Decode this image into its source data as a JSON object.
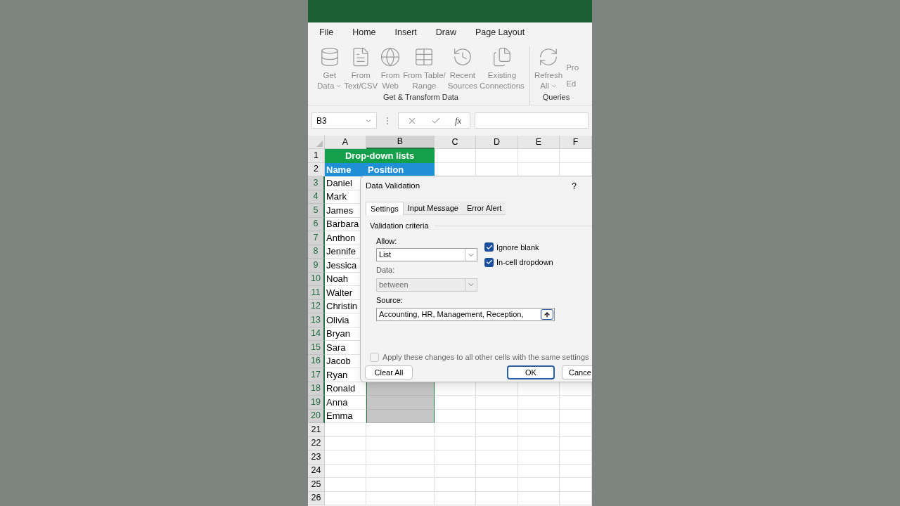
{
  "ribbon_tabs": [
    {
      "label": "File"
    },
    {
      "label": "Home"
    },
    {
      "label": "Insert"
    },
    {
      "label": "Draw"
    },
    {
      "label": "Page Layout"
    }
  ],
  "ribbon_groups": [
    {
      "label": "Get & Transform Data",
      "buttons": [
        {
          "kind": "database",
          "lines": [
            "Get",
            "Data"
          ],
          "dropdown": true
        },
        {
          "kind": "document",
          "lines": [
            "From",
            "Text/CSV"
          ],
          "dropdown": false
        },
        {
          "kind": "web",
          "lines": [
            "From",
            "Web"
          ],
          "dropdown": false
        },
        {
          "kind": "table",
          "lines": [
            "From Table/",
            "Range"
          ],
          "dropdown": false
        },
        {
          "kind": "recent",
          "lines": [
            "Recent",
            "Sources"
          ],
          "dropdown": false
        },
        {
          "kind": "existing",
          "lines": [
            "Existing",
            "Connections"
          ],
          "dropdown": false
        }
      ]
    },
    {
      "label": "Queries",
      "buttons": [
        {
          "kind": "refresh",
          "lines": [
            "Refresh",
            "All"
          ],
          "dropdown": true
        }
      ],
      "small_items": [
        "Pro",
        "Ed"
      ]
    }
  ],
  "name_box": "B3",
  "formula_function": "fx",
  "columns": [
    {
      "label": "A",
      "selected": false
    },
    {
      "label": "B",
      "selected": true
    },
    {
      "label": "C",
      "selected": false
    },
    {
      "label": "D",
      "selected": false
    },
    {
      "label": "E",
      "selected": false
    },
    {
      "label": "F",
      "selected": false
    }
  ],
  "title_row": {
    "number": "1",
    "text": "Drop-down lists"
  },
  "header_row": {
    "number": "2",
    "cells": [
      "Name",
      "Position"
    ]
  },
  "rows": [
    {
      "number": "3",
      "name": "Daniel",
      "selected": true
    },
    {
      "number": "4",
      "name": "Mark",
      "selected": true
    },
    {
      "number": "5",
      "name": "James",
      "selected": true
    },
    {
      "number": "6",
      "name": "Barbara",
      "selected": true
    },
    {
      "number": "7",
      "name": "Anthon",
      "selected": true
    },
    {
      "number": "8",
      "name": "Jennife",
      "selected": true
    },
    {
      "number": "9",
      "name": "Jessica",
      "selected": true
    },
    {
      "number": "10",
      "name": "Noah",
      "selected": true
    },
    {
      "number": "11",
      "name": "Walter",
      "selected": true
    },
    {
      "number": "12",
      "name": "Christin",
      "selected": true
    },
    {
      "number": "13",
      "name": "Olivia",
      "selected": true
    },
    {
      "number": "14",
      "name": "Bryan",
      "selected": true
    },
    {
      "number": "15",
      "name": "Sara",
      "selected": true
    },
    {
      "number": "16",
      "name": "Jacob",
      "selected": true
    },
    {
      "number": "17",
      "name": "Ryan",
      "selected": true
    },
    {
      "number": "18",
      "name": "Ronald",
      "selected": true
    },
    {
      "number": "19",
      "name": "Anna",
      "selected": true
    },
    {
      "number": "20",
      "name": "Emma",
      "selected": true
    },
    {
      "number": "21",
      "selected": false
    },
    {
      "number": "22",
      "selected": false
    },
    {
      "number": "23",
      "selected": false
    },
    {
      "number": "24",
      "selected": false
    },
    {
      "number": "25",
      "selected": false
    },
    {
      "number": "26",
      "selected": false
    }
  ],
  "dialog": {
    "title": "Data Validation",
    "help": "?",
    "tabs": [
      {
        "label": "Settings",
        "selected": true
      },
      {
        "label": "Input Message",
        "selected": false
      },
      {
        "label": "Error Alert",
        "selected": false
      }
    ],
    "section": "Validation criteria",
    "allow": {
      "label": "Allow:",
      "value": "List",
      "disabled": false
    },
    "data": {
      "label": "Data:",
      "value": "between",
      "disabled": true
    },
    "checkboxes": [
      {
        "label": "Ignore blank",
        "checked": true
      },
      {
        "label": "In-cell dropdown",
        "checked": true
      }
    ],
    "source": {
      "label": "Source:",
      "value": "Accounting, HR, Management, Reception, "
    },
    "apply": {
      "label": "Apply these changes to all other cells with the same settings",
      "checked": false
    },
    "buttons": [
      {
        "label": "Clear All",
        "default": false
      },
      {
        "label": "OK",
        "default": true
      },
      {
        "label": "Cance",
        "default": false
      }
    ]
  }
}
